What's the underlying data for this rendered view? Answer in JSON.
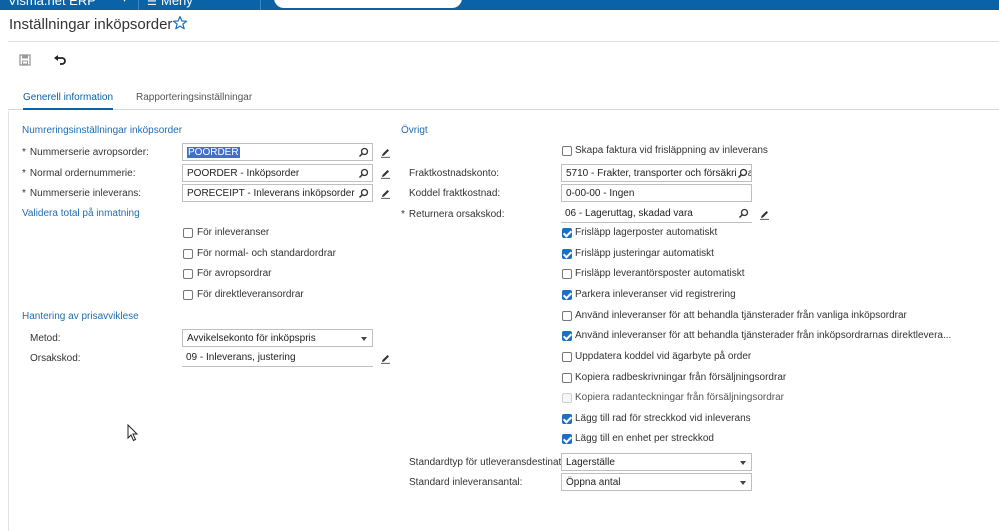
{
  "app": {
    "brand": "Visma.net ERP",
    "menu_label": "Meny"
  },
  "page": {
    "title": "Inställningar inköpsorder"
  },
  "tabs": [
    {
      "label": "Generell information"
    },
    {
      "label": "Rapporteringsinställningar"
    }
  ],
  "numbering": {
    "section_title": "Numreringsinställningar inköpsorder",
    "rows": [
      {
        "label": "Nummerserie avropsorder:",
        "value": "POORDER"
      },
      {
        "label": "Normal ordernummerie:",
        "value": "POORDER - Inköpsorder"
      },
      {
        "label": "Nummerserie inleverans:",
        "value": "PORECEIPT - Inleverans inköpsorder"
      }
    ]
  },
  "validate": {
    "section_title": "Validera total på inmatning",
    "items": [
      {
        "label": "För inleveranser",
        "checked": false
      },
      {
        "label": "För normal- och standardordrar",
        "checked": false
      },
      {
        "label": "För avropsordrar",
        "checked": false
      },
      {
        "label": "För direktleveransordrar",
        "checked": false
      }
    ]
  },
  "price_variance": {
    "section_title": "Hantering av prisavviklese",
    "method_label": "Metod:",
    "method_value": "Avvikelsekonto för inköpspris",
    "reason_label": "Orsakskod:",
    "reason_value": "09 - Inleverans, justering"
  },
  "other": {
    "section_title": "Övrigt",
    "create_invoice_label": "Skapa faktura vid frisläppning av inleverans",
    "create_invoice_checked": false,
    "freight_account_label": "Fraktkostnadskonto:",
    "freight_account_value": "5710 - Frakter, transporter och försäkringar",
    "freight_code_label": "Koddel fraktkostnad:",
    "freight_code_value": "0-00-00 - Ingen",
    "return_reason_label": "Returnera orsakskod:",
    "return_reason_value": "06 - Lageruttag, skadad vara",
    "checkboxes": [
      {
        "label": "Frisläpp lagerposter automatiskt",
        "checked": true
      },
      {
        "label": "Frisläpp justeringar automatiskt",
        "checked": true
      },
      {
        "label": "Frisläpp leverantörsposter automatiskt",
        "checked": false
      },
      {
        "label": "Parkera inleveranser vid registrering",
        "checked": true
      },
      {
        "label": "Använd inleveranser för att behandla tjänsterader från vanliga inköpsordrar",
        "checked": false
      },
      {
        "label": "Använd inleveranser för att behandla tjänsterader från inköpsordrarnas direktlevera...",
        "checked": true
      },
      {
        "label": "Uppdatera koddel vid ägarbyte på order",
        "checked": false
      },
      {
        "label": "Kopiera radbeskrivningar från försäljningsordrar",
        "checked": false
      },
      {
        "label": "Kopiera radanteckningar från försäljningsordrar",
        "checked": false,
        "disabled": true
      },
      {
        "label": "Lägg till rad för streckkod vid inleverans",
        "checked": true
      },
      {
        "label": "Lägg till en enhet per streckkod",
        "checked": true
      }
    ],
    "shipping_dest_label": "Standardtyp för utleveransdestinati...",
    "shipping_dest_value": "Lagerställe",
    "receipt_qty_label": "Standard inleveransantal:",
    "receipt_qty_value": "Öppna antal"
  },
  "icons": {
    "save": "save-icon",
    "undo": "undo-icon",
    "favorite": "star-icon",
    "search": "search-icon",
    "edit": "pencil-icon"
  },
  "colors": {
    "accent": "#0b63a7",
    "link": "#1f6db3",
    "checked": "#1b6fc4"
  }
}
